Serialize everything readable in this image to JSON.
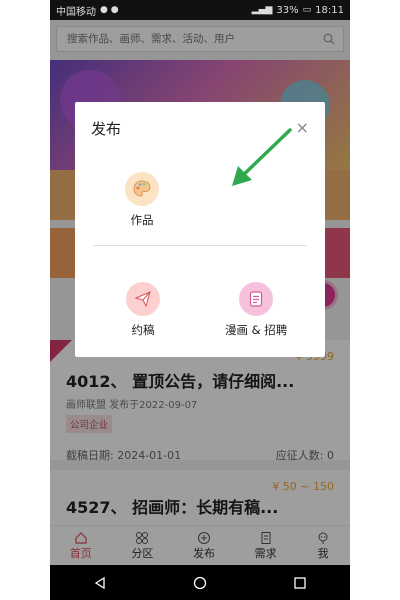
{
  "status": {
    "carrier": "中国移动",
    "battery": "33%",
    "time": "18:11"
  },
  "search": {
    "placeholder": "搜索作品、画师、需求、活动、用户"
  },
  "dialog": {
    "title": "发布",
    "options": [
      {
        "label": "作品"
      },
      {
        "label": "约稿"
      },
      {
        "label": "漫画 & 招聘"
      }
    ]
  },
  "cards": [
    {
      "title": "4012、 置顶公告，请仔细阅...",
      "meta": "画师联盟 发布于2022-09-07",
      "tag": "公司企业",
      "deadline": "截稿日期: 2024-01-01",
      "applicants": "应征人数: 0",
      "price": "¥ 9999"
    },
    {
      "title": "4527、 招画师：长期有稿...",
      "price": "¥ 50 ~ 150"
    }
  ],
  "tabbar": {
    "items": [
      {
        "label": "首页",
        "icon": "home-icon",
        "active": true
      },
      {
        "label": "分区",
        "icon": "grid-icon"
      },
      {
        "label": "发布",
        "icon": "plus-circle-icon"
      },
      {
        "label": "需求",
        "icon": "document-icon"
      },
      {
        "label": "我",
        "icon": "user-icon"
      }
    ]
  },
  "colors": {
    "accent": "#e04c5c",
    "orange": "#f0b16e",
    "arrow": "#2fa84f"
  }
}
